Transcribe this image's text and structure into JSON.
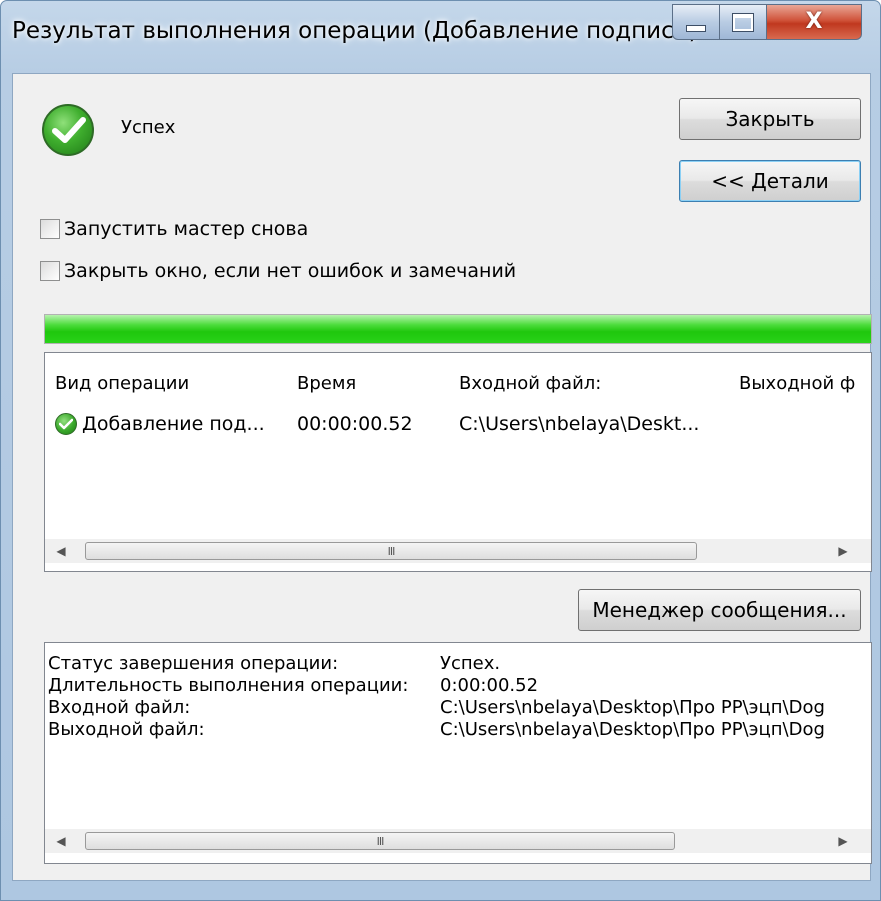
{
  "window": {
    "title": "Результат выполнения операции (Добавление подписи)",
    "controls": {
      "minimize": "minimize",
      "maximize": "maximize",
      "close": "X"
    }
  },
  "status": {
    "label": "Успех",
    "icon": "success-check-icon"
  },
  "buttons": {
    "close": "Закрыть",
    "details": "<< Детали",
    "manager": "Менеджер сообщения..."
  },
  "options": {
    "rerun_wizard": {
      "label": "Запустить мастер снова",
      "checked": false
    },
    "close_if_no_errors": {
      "label": "Закрыть окно, если нет ошибок и замечаний",
      "checked": false
    }
  },
  "progress": {
    "fraction": 1.0,
    "color": "#22cc10"
  },
  "operations_table": {
    "columns": [
      "Вид операции",
      "Время",
      "Входной файл:",
      "Выходной ф"
    ],
    "rows": [
      {
        "icon": "success-check-icon",
        "operation": "Добавление под...",
        "time": "00:00:00.52",
        "input_file": "C:\\Users\\nbelaya\\Deskt..."
      }
    ],
    "scrollbar_thumb": "III"
  },
  "details": {
    "lines": [
      {
        "label": "Статус завершения операции:",
        "value": "Успех."
      },
      {
        "label": "Длительность выполнения операции:",
        "value": "0:00:00.52"
      },
      {
        "label": "Входной файл:",
        "value": "C:\\Users\\nbelaya\\Desktop\\Про РР\\эцп\\Dog"
      },
      {
        "label": "Выходной файл:",
        "value": "C:\\Users\\nbelaya\\Desktop\\Про РР\\эцп\\Dog"
      }
    ],
    "scrollbar_thumb": "III"
  },
  "colors": {
    "accent_green": "#22cc10",
    "close_red": "#c9432a",
    "frame_blue": "#b7cde4"
  }
}
